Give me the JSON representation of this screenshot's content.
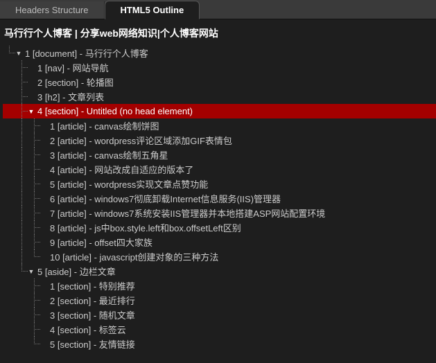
{
  "tabs": {
    "headers": "Headers Structure",
    "outline": "HTML5 Outline",
    "active": "outline"
  },
  "title": "马行行个人博客 | 分享web网络知识|个人博客网站",
  "tree": {
    "root": {
      "label": "1 [document] - 马行行个人博客",
      "expanded": true,
      "children": [
        {
          "label": "1 [nav] - 网站导航"
        },
        {
          "label": "2 [section] - 轮播图"
        },
        {
          "label": "3 [h2] - 文章列表"
        },
        {
          "label": "4 [section] - Untitled (no head element)",
          "expanded": true,
          "selected": true,
          "children": [
            {
              "label": "1 [article] - canvas绘制饼图"
            },
            {
              "label": "2 [article] - wordpress评论区域添加GIF表情包"
            },
            {
              "label": "3 [article] - canvas绘制五角星"
            },
            {
              "label": "4 [article] - 网站改成自适应的版本了"
            },
            {
              "label": "5 [article] - wordpress实现文章点赞功能"
            },
            {
              "label": "6 [article] - windows7彻底卸载Internet信息服务(IIS)管理器"
            },
            {
              "label": "7 [article] - windows7系统安装IIS管理器并本地搭建ASP网站配置环境"
            },
            {
              "label": "8 [article] - js中box.style.left和box.offsetLeft区别"
            },
            {
              "label": "9 [article] - offset四大家族"
            },
            {
              "label": "10 [article] - javascript创建对象的三种方法"
            }
          ]
        },
        {
          "label": "5 [aside] - 边栏文章",
          "expanded": true,
          "children": [
            {
              "label": "1 [section] - 特别推荐"
            },
            {
              "label": "2 [section] - 最近排行"
            },
            {
              "label": "3 [section] - 随机文章"
            },
            {
              "label": "4 [section] - 标签云"
            },
            {
              "label": "5 [section] - 友情链接"
            }
          ]
        }
      ]
    }
  }
}
